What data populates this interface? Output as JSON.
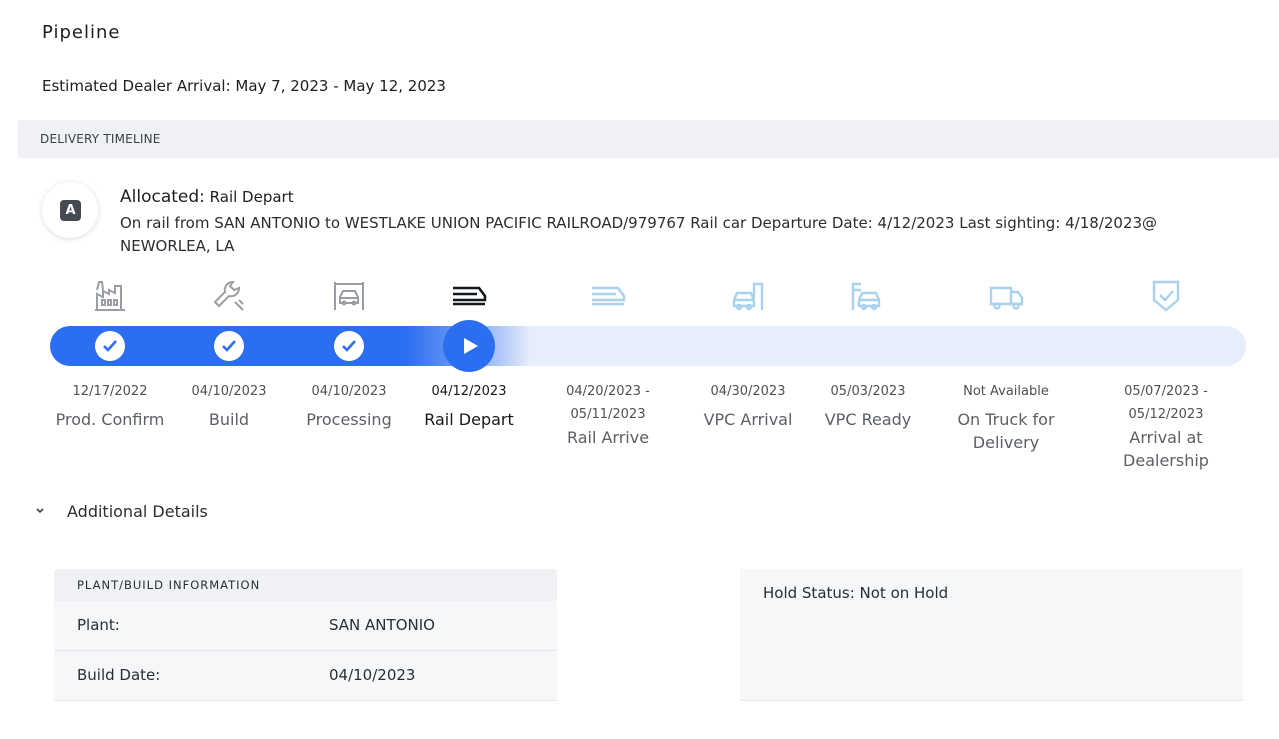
{
  "page": {
    "title": "Pipeline",
    "estimated_arrival": "Estimated Dealer Arrival: May 7, 2023 - May 12, 2023"
  },
  "timeline": {
    "header": "DELIVERY TIMELINE",
    "status_badge": "A",
    "status_label": "Allocated:",
    "status_value": "Rail Depart",
    "status_description": "On rail from SAN ANTONIO to WESTLAKE UNION PACIFIC RAILROAD/979767 Rail car Departure Date: 4/12/2023 Last sighting: 4/18/2023@ NEWORLEA, LA",
    "progress_completed_steps": 3,
    "progress_current_step": 4,
    "progress_total_steps": 9,
    "colors": {
      "active": "#2b6ef0",
      "done_icon": "#9a9ea4",
      "pending_icon": "#a8d2ee",
      "track": "#e6edfb"
    },
    "steps": [
      {
        "date": "12/17/2022",
        "label": "Prod. Confirm",
        "icon": "factory-icon",
        "state": "done"
      },
      {
        "date": "04/10/2023",
        "label": "Build",
        "icon": "wrench-icon",
        "state": "done"
      },
      {
        "date": "04/10/2023",
        "label": "Processing",
        "icon": "car-processing-icon",
        "state": "done"
      },
      {
        "date": "04/12/2023",
        "label": "Rail Depart",
        "icon": "train-icon",
        "state": "current"
      },
      {
        "date": "04/20/2023 - 05/11/2023",
        "label": "Rail Arrive",
        "icon": "train-arrive-icon",
        "state": "pending"
      },
      {
        "date": "04/30/2023",
        "label": "VPC Arrival",
        "icon": "car-arrival-icon",
        "state": "pending"
      },
      {
        "date": "05/03/2023",
        "label": "VPC Ready",
        "icon": "car-ready-icon",
        "state": "pending"
      },
      {
        "date": "Not Available",
        "label": "On Truck for Delivery",
        "icon": "truck-icon",
        "state": "pending"
      },
      {
        "date": "05/07/2023 - 05/12/2023",
        "label": "Arrival at Dealership",
        "icon": "shield-check-icon",
        "state": "pending"
      }
    ]
  },
  "details": {
    "toggle_label": "Additional Details",
    "plant_panel": {
      "header": "PLANT/BUILD INFORMATION",
      "rows": [
        {
          "key": "Plant:",
          "value": "SAN ANTONIO"
        },
        {
          "key": "Build Date:",
          "value": "04/10/2023"
        }
      ]
    },
    "hold_status": "Hold Status: Not on Hold"
  }
}
